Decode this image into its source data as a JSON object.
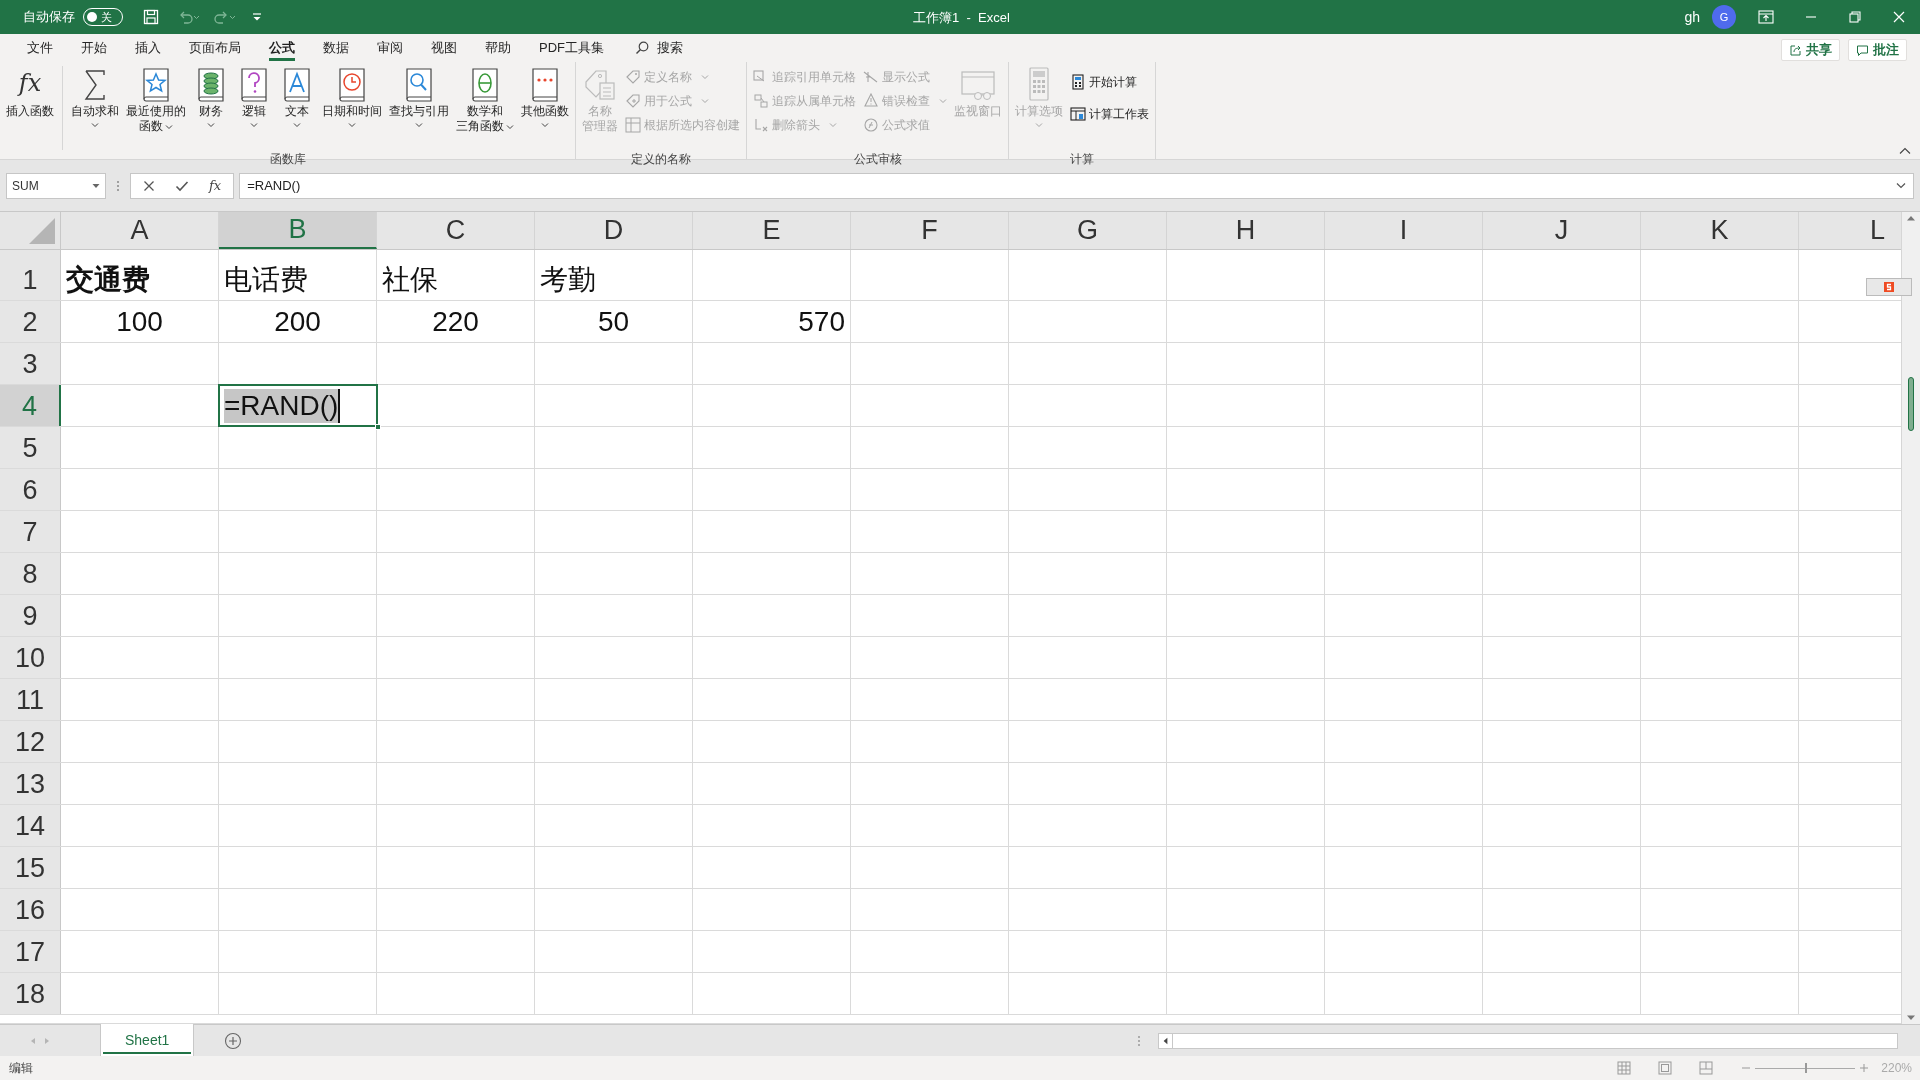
{
  "title_bar": {
    "autosave": {
      "label": "自动保存",
      "state_label": "关",
      "on": false
    },
    "title": "工作簿1  -  Excel",
    "user": "gh",
    "avatar": "G"
  },
  "menu_tabs": [
    {
      "label": "文件",
      "selected": false
    },
    {
      "label": "开始",
      "selected": false
    },
    {
      "label": "插入",
      "selected": false
    },
    {
      "label": "页面布局",
      "selected": false
    },
    {
      "label": "公式",
      "selected": true
    },
    {
      "label": "数据",
      "selected": false
    },
    {
      "label": "审阅",
      "selected": false
    },
    {
      "label": "视图",
      "selected": false
    },
    {
      "label": "帮助",
      "selected": false
    },
    {
      "label": "PDF工具集",
      "selected": false
    }
  ],
  "search": {
    "label": "搜索"
  },
  "share_button": "共享",
  "comments_button": "批注",
  "ribbon_groups": [
    {
      "title": "函数库",
      "items": [
        {
          "kind": "large",
          "icon_text": "fx",
          "lines": [
            "插入函数"
          ],
          "dropdown": false,
          "disabled": false
        },
        {
          "kind": "large",
          "lines": [
            "自动求和"
          ],
          "dropdown": true,
          "disabled": false
        },
        {
          "kind": "large",
          "lines": [
            "最近使用的",
            "函数"
          ],
          "dropdown": true,
          "disabled": false
        },
        {
          "kind": "large",
          "lines": [
            "财务"
          ],
          "dropdown": true,
          "disabled": false
        },
        {
          "kind": "large",
          "lines": [
            "逻辑"
          ],
          "dropdown": true,
          "disabled": false
        },
        {
          "kind": "large",
          "lines": [
            "文本"
          ],
          "dropdown": true,
          "disabled": false
        },
        {
          "kind": "large",
          "lines": [
            "日期和时间"
          ],
          "dropdown": true,
          "disabled": false
        },
        {
          "kind": "large",
          "lines": [
            "查找与引用"
          ],
          "dropdown": true,
          "disabled": false
        },
        {
          "kind": "large",
          "lines": [
            "数学和",
            "三角函数"
          ],
          "dropdown": true,
          "disabled": false
        },
        {
          "kind": "large",
          "lines": [
            "其他函数"
          ],
          "dropdown": true,
          "disabled": false
        }
      ]
    },
    {
      "title": "定义的名称",
      "items": [
        {
          "kind": "large",
          "lines": [
            "名称",
            "管理器"
          ],
          "dropdown": false,
          "disabled": true
        },
        {
          "kind": "stack",
          "items": [
            {
              "label": "定义名称",
              "dropdown": true,
              "disabled": true
            },
            {
              "label": "用于公式",
              "dropdown": true,
              "disabled": true
            },
            {
              "label": "根据所选内容创建",
              "dropdown": false,
              "disabled": true
            }
          ]
        }
      ]
    },
    {
      "title": "公式审核",
      "items": [
        {
          "kind": "stack",
          "items": [
            {
              "label": "追踪引用单元格",
              "dropdown": false,
              "disabled": true
            },
            {
              "label": "追踪从属单元格",
              "dropdown": false,
              "disabled": true
            },
            {
              "label": "删除箭头",
              "dropdown": true,
              "disabled": true
            }
          ]
        },
        {
          "kind": "stack",
          "items": [
            {
              "label": "显示公式",
              "dropdown": false,
              "disabled": true
            },
            {
              "label": "错误检查",
              "dropdown": true,
              "disabled": true
            },
            {
              "label": "公式求值",
              "dropdown": false,
              "disabled": true
            }
          ]
        },
        {
          "kind": "large",
          "lines": [
            "监视窗口"
          ],
          "dropdown": false,
          "disabled": true
        }
      ]
    },
    {
      "title": "计算",
      "items": [
        {
          "kind": "large",
          "lines": [
            "计算选项"
          ],
          "dropdown": true,
          "disabled": true
        },
        {
          "kind": "stack",
          "items": [
            {
              "label": "开始计算",
              "dropdown": false,
              "disabled": false
            },
            {
              "label": "计算工作表",
              "dropdown": false,
              "disabled": false
            }
          ]
        }
      ]
    }
  ],
  "formula_bar": {
    "name_box": "SUM",
    "fx_button": "fx",
    "formula": "=RAND()"
  },
  "columns": [
    {
      "label": "A",
      "selected": false
    },
    {
      "label": "B",
      "selected": true
    },
    {
      "label": "C",
      "selected": false
    },
    {
      "label": "D",
      "selected": false
    },
    {
      "label": "E",
      "selected": false
    },
    {
      "label": "F",
      "selected": false
    },
    {
      "label": "G",
      "selected": false
    },
    {
      "label": "H",
      "selected": false
    },
    {
      "label": "I",
      "selected": false
    },
    {
      "label": "J",
      "selected": false
    },
    {
      "label": "K",
      "selected": false
    },
    {
      "label": "L",
      "selected": false
    }
  ],
  "rows": [
    {
      "label": "1",
      "selected": false,
      "cells": [
        {
          "value": "交通费",
          "bold": true,
          "kind": "text",
          "selected": false
        },
        {
          "value": "电话费",
          "bold": false,
          "kind": "text",
          "selected": false
        },
        {
          "value": "社保",
          "bold": false,
          "kind": "text",
          "selected": false
        },
        {
          "value": "考勤",
          "bold": false,
          "kind": "text",
          "selected": false
        }
      ]
    },
    {
      "label": "2",
      "selected": false,
      "cells": [
        {
          "value": "100",
          "bold": false,
          "kind": "centered",
          "selected": false
        },
        {
          "value": "200",
          "bold": false,
          "kind": "centered",
          "selected": false
        },
        {
          "value": "220",
          "bold": false,
          "kind": "centered",
          "selected": false
        },
        {
          "value": "50",
          "bold": false,
          "kind": "centered",
          "selected": false
        },
        {
          "value": "570",
          "bold": false,
          "kind": "number",
          "selected": false
        }
      ]
    },
    {
      "label": "3",
      "selected": false
    },
    {
      "label": "4",
      "selected": true,
      "cells": [
        null,
        {
          "value": "=RAND()",
          "bold": false,
          "kind": "text",
          "selected": true
        }
      ]
    },
    {
      "label": "5",
      "selected": false
    },
    {
      "label": "6",
      "selected": false
    },
    {
      "label": "7",
      "selected": false
    },
    {
      "label": "8",
      "selected": false
    },
    {
      "label": "9",
      "selected": false
    },
    {
      "label": "10",
      "selected": false
    },
    {
      "label": "11",
      "selected": false
    },
    {
      "label": "12",
      "selected": false
    },
    {
      "label": "13",
      "selected": false
    },
    {
      "label": "14",
      "selected": false
    },
    {
      "label": "15",
      "selected": false
    },
    {
      "label": "16",
      "selected": false
    },
    {
      "label": "17",
      "selected": false
    },
    {
      "label": "18",
      "selected": false
    }
  ],
  "sheet_tabs": [
    {
      "label": "Sheet1",
      "selected": true
    }
  ],
  "status_bar": {
    "mode": "编辑",
    "zoom": {
      "level": 0.5,
      "reading": "220%"
    }
  }
}
